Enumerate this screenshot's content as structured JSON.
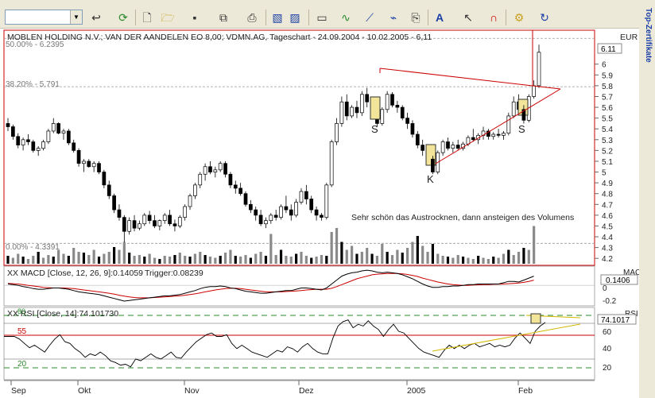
{
  "toolbar": {
    "symbol_input_value": "",
    "icons": [
      "back-icon",
      "refresh-icon",
      "new-document-icon",
      "open-folder-icon",
      "save-icon",
      "copy-icon",
      "print-icon",
      "chart-1-icon",
      "chart-2-icon",
      "layout-icon",
      "indicator-icon",
      "drawing-icon",
      "analysis-icon",
      "export-icon",
      "text-tool-icon",
      "pointer-icon",
      "magnet-icon",
      "settings-icon",
      "reload-icon"
    ]
  },
  "sidebar": {
    "vertical_label": "Top-Zertifikate"
  },
  "price_panel": {
    "title": "MOBLEN HOLDING N.V.; VAN DER AANDELEN EO 8,00; VDMN.AG, Tageschart - 24.09.2004 - 10.02.2005 - 6,11",
    "currency_label": "EUR",
    "current_price_badge": "6.11",
    "fib_labels": [
      "50.00% - 6.2395",
      "38.20% - 5.791",
      "0.00% - 4.3391"
    ],
    "pattern_labels": [
      "S",
      "K",
      "S"
    ],
    "annotation": "Sehr schön das Austrocknen, dann ansteigen des Volumens",
    "y_ticks": [
      "6",
      "5.9",
      "5.8",
      "5.7",
      "5.6",
      "5.5",
      "5.4",
      "5.3",
      "5.2",
      "5.1",
      "5",
      "4.9",
      "4.8",
      "4.7",
      "4.6",
      "4.5",
      "4.4",
      "4.3",
      "4.2"
    ]
  },
  "macd_panel": {
    "label_name": "XX MACD [Close, 12, 26, 9]:0.14059",
    "label_trigger": "Trigger:0.08239",
    "title_right": "MACD",
    "value_badge": "0.1406",
    "y_ticks": [
      "0",
      "-0.2"
    ]
  },
  "rsi_panel": {
    "label": "XX RSI [Close, 14]:74.101730",
    "title_right": "RSI",
    "value_badge": "74.1017",
    "level_labels": [
      "80",
      "55",
      "20"
    ],
    "y_ticks": [
      "60",
      "40",
      "20"
    ]
  },
  "x_axis": {
    "labels": [
      "Sep",
      "Okt",
      "Nov",
      "Dez",
      "2005",
      "Feb"
    ]
  },
  "colors": {
    "frame_red": "#cc0000",
    "price_up": "#ffffff",
    "price_down": "#000000",
    "macd_line": "#000000",
    "trigger_line": "#cc0000",
    "rsi_line": "#000000",
    "trend_yellow": "#d4b800",
    "fib_line": "#9a9a9a",
    "highlight_box": "#f2e59a"
  },
  "chart_data": {
    "type": "candlestick",
    "ylim": [
      4.15,
      6.3
    ],
    "candles": [
      [
        5.45,
        5.5,
        5.38,
        5.42
      ],
      [
        5.42,
        5.44,
        5.3,
        5.33
      ],
      [
        5.33,
        5.36,
        5.22,
        5.25
      ],
      [
        5.25,
        5.32,
        5.2,
        5.3
      ],
      [
        5.3,
        5.35,
        5.25,
        5.28
      ],
      [
        5.28,
        5.3,
        5.18,
        5.2
      ],
      [
        5.2,
        5.24,
        5.15,
        5.22
      ],
      [
        5.22,
        5.3,
        5.2,
        5.28
      ],
      [
        5.28,
        5.4,
        5.26,
        5.38
      ],
      [
        5.38,
        5.5,
        5.36,
        5.45
      ],
      [
        5.45,
        5.46,
        5.35,
        5.36
      ],
      [
        5.36,
        5.4,
        5.3,
        5.38
      ],
      [
        5.38,
        5.4,
        5.25,
        5.27
      ],
      [
        5.27,
        5.3,
        5.18,
        5.2
      ],
      [
        5.2,
        5.22,
        5.05,
        5.08
      ],
      [
        5.08,
        5.12,
        5.0,
        5.1
      ],
      [
        5.1,
        5.12,
        5.04,
        5.05
      ],
      [
        5.05,
        5.1,
        5.0,
        5.08
      ],
      [
        5.08,
        5.1,
        4.98,
        5.0
      ],
      [
        5.0,
        5.02,
        4.85,
        4.88
      ],
      [
        4.88,
        4.92,
        4.75,
        4.78
      ],
      [
        4.78,
        4.8,
        4.62,
        4.65
      ],
      [
        4.65,
        4.7,
        4.55,
        4.58
      ],
      [
        4.58,
        4.6,
        4.35,
        4.45
      ],
      [
        4.45,
        4.58,
        4.42,
        4.55
      ],
      [
        4.55,
        4.6,
        4.45,
        4.48
      ],
      [
        4.48,
        4.55,
        4.46,
        4.52
      ],
      [
        4.52,
        4.62,
        4.5,
        4.6
      ],
      [
        4.6,
        4.64,
        4.52,
        4.55
      ],
      [
        4.55,
        4.6,
        4.48,
        4.5
      ],
      [
        4.5,
        4.56,
        4.46,
        4.55
      ],
      [
        4.55,
        4.62,
        4.52,
        4.6
      ],
      [
        4.6,
        4.65,
        4.5,
        4.52
      ],
      [
        4.52,
        4.56,
        4.45,
        4.5
      ],
      [
        4.5,
        4.6,
        4.48,
        4.58
      ],
      [
        4.58,
        4.7,
        4.55,
        4.68
      ],
      [
        4.68,
        4.8,
        4.65,
        4.78
      ],
      [
        4.78,
        4.9,
        4.75,
        4.88
      ],
      [
        4.88,
        5.0,
        4.85,
        4.98
      ],
      [
        4.98,
        5.08,
        4.92,
        5.05
      ],
      [
        5.05,
        5.1,
        4.98,
        5.0
      ],
      [
        5.0,
        5.05,
        4.95,
        5.02
      ],
      [
        5.02,
        5.1,
        5.0,
        5.08
      ],
      [
        5.08,
        5.1,
        4.95,
        4.98
      ],
      [
        4.98,
        5.0,
        4.85,
        4.88
      ],
      [
        4.88,
        4.92,
        4.8,
        4.85
      ],
      [
        4.85,
        4.9,
        4.78,
        4.8
      ],
      [
        4.8,
        4.82,
        4.68,
        4.7
      ],
      [
        4.7,
        4.74,
        4.62,
        4.65
      ],
      [
        4.65,
        4.68,
        4.55,
        4.6
      ],
      [
        4.6,
        4.65,
        4.5,
        4.52
      ],
      [
        4.52,
        4.58,
        4.48,
        4.55
      ],
      [
        4.55,
        4.62,
        4.52,
        4.6
      ],
      [
        4.6,
        4.65,
        4.55,
        4.58
      ],
      [
        4.58,
        4.7,
        4.56,
        4.68
      ],
      [
        4.68,
        4.78,
        4.62,
        4.65
      ],
      [
        4.65,
        4.7,
        4.55,
        4.6
      ],
      [
        4.6,
        4.75,
        4.58,
        4.72
      ],
      [
        4.72,
        4.85,
        4.7,
        4.82
      ],
      [
        4.82,
        4.88,
        4.7,
        4.75
      ],
      [
        4.75,
        4.78,
        4.62,
        4.65
      ],
      [
        4.65,
        4.68,
        4.55,
        4.6
      ],
      [
        4.6,
        4.62,
        4.55,
        4.58
      ],
      [
        4.58,
        4.9,
        4.56,
        4.88
      ],
      [
        4.88,
        5.3,
        4.86,
        5.28
      ],
      [
        5.28,
        5.5,
        5.25,
        5.45
      ],
      [
        5.45,
        5.7,
        5.42,
        5.65
      ],
      [
        5.65,
        5.72,
        5.48,
        5.52
      ],
      [
        5.52,
        5.62,
        5.5,
        5.6
      ],
      [
        5.6,
        5.66,
        5.5,
        5.55
      ],
      [
        5.55,
        5.75,
        5.52,
        5.72
      ],
      [
        5.72,
        5.78,
        5.6,
        5.65
      ],
      [
        5.65,
        5.7,
        5.55,
        5.6
      ],
      [
        5.6,
        5.62,
        5.42,
        5.45
      ],
      [
        5.45,
        5.6,
        5.43,
        5.58
      ],
      [
        5.58,
        5.75,
        5.55,
        5.72
      ],
      [
        5.72,
        5.74,
        5.6,
        5.62
      ],
      [
        5.62,
        5.66,
        5.55,
        5.6
      ],
      [
        5.6,
        5.62,
        5.48,
        5.5
      ],
      [
        5.5,
        5.55,
        5.4,
        5.45
      ],
      [
        5.45,
        5.48,
        5.32,
        5.35
      ],
      [
        5.35,
        5.38,
        5.22,
        5.25
      ],
      [
        5.25,
        5.3,
        5.15,
        5.2
      ],
      [
        5.2,
        5.22,
        5.1,
        5.12
      ],
      [
        5.12,
        5.15,
        4.98,
        5.0
      ],
      [
        5.0,
        5.2,
        4.98,
        5.18
      ],
      [
        5.18,
        5.3,
        5.15,
        5.28
      ],
      [
        5.28,
        5.32,
        5.2,
        5.22
      ],
      [
        5.22,
        5.28,
        5.18,
        5.25
      ],
      [
        5.25,
        5.3,
        5.2,
        5.22
      ],
      [
        5.22,
        5.28,
        5.2,
        5.26
      ],
      [
        5.26,
        5.34,
        5.24,
        5.32
      ],
      [
        5.32,
        5.4,
        5.28,
        5.3
      ],
      [
        5.3,
        5.36,
        5.26,
        5.34
      ],
      [
        5.34,
        5.42,
        5.3,
        5.38
      ],
      [
        5.38,
        5.4,
        5.3,
        5.33
      ],
      [
        5.33,
        5.37,
        5.3,
        5.35
      ],
      [
        5.35,
        5.4,
        5.32,
        5.34
      ],
      [
        5.34,
        5.38,
        5.3,
        5.36
      ],
      [
        5.36,
        5.55,
        5.34,
        5.52
      ],
      [
        5.52,
        5.7,
        5.5,
        5.65
      ],
      [
        5.65,
        5.72,
        5.55,
        5.58
      ],
      [
        5.58,
        5.62,
        5.45,
        5.48
      ],
      [
        5.48,
        5.72,
        5.46,
        5.7
      ],
      [
        5.7,
        5.85,
        5.68,
        5.8
      ],
      [
        5.8,
        6.18,
        5.78,
        6.11
      ]
    ],
    "volume": [
      0.2,
      0.15,
      0.25,
      0.18,
      0.12,
      0.2,
      0.3,
      0.15,
      0.22,
      0.18,
      0.35,
      0.25,
      0.2,
      0.4,
      0.3,
      0.28,
      0.22,
      0.35,
      0.18,
      0.25,
      0.3,
      0.42,
      0.35,
      0.55,
      0.28,
      0.2,
      0.22,
      0.18,
      0.25,
      0.15,
      0.12,
      0.2,
      0.18,
      0.22,
      0.28,
      0.2,
      0.18,
      0.25,
      0.3,
      0.22,
      0.18,
      0.15,
      0.2,
      0.28,
      0.35,
      0.2,
      0.18,
      0.22,
      0.15,
      0.25,
      0.3,
      0.2,
      0.75,
      0.22,
      0.35,
      0.2,
      0.18,
      0.25,
      0.3,
      0.2,
      0.15,
      0.18,
      0.22,
      0.2,
      0.8,
      0.9,
      0.55,
      0.35,
      0.45,
      0.25,
      0.3,
      0.4,
      0.25,
      0.2,
      0.5,
      0.3,
      0.22,
      0.35,
      0.28,
      0.4,
      0.55,
      0.7,
      0.45,
      0.3,
      0.5,
      0.25,
      0.2,
      0.18,
      0.15,
      0.22,
      0.18,
      0.15,
      0.12,
      0.2,
      0.15,
      0.12,
      0.18,
      0.15,
      0.25,
      0.35,
      0.22,
      0.3,
      0.4,
      0.35,
      0.95
    ],
    "macd": [
      0.02,
      0.01,
      0.0,
      -0.02,
      -0.03,
      -0.05,
      -0.06,
      -0.06,
      -0.05,
      -0.04,
      -0.04,
      -0.05,
      -0.06,
      -0.08,
      -0.1,
      -0.11,
      -0.12,
      -0.13,
      -0.14,
      -0.16,
      -0.18,
      -0.2,
      -0.22,
      -0.24,
      -0.23,
      -0.22,
      -0.21,
      -0.2,
      -0.19,
      -0.18,
      -0.17,
      -0.16,
      -0.16,
      -0.15,
      -0.14,
      -0.12,
      -0.1,
      -0.08,
      -0.05,
      -0.03,
      -0.02,
      -0.02,
      -0.01,
      -0.02,
      -0.04,
      -0.05,
      -0.07,
      -0.09,
      -0.1,
      -0.11,
      -0.12,
      -0.12,
      -0.11,
      -0.1,
      -0.09,
      -0.08,
      -0.08,
      -0.06,
      -0.04,
      -0.04,
      -0.05,
      -0.06,
      -0.07,
      -0.04,
      0.02,
      0.08,
      0.14,
      0.17,
      0.19,
      0.2,
      0.22,
      0.23,
      0.22,
      0.2,
      0.19,
      0.2,
      0.19,
      0.18,
      0.16,
      0.13,
      0.1,
      0.06,
      0.02,
      -0.01,
      -0.03,
      -0.03,
      -0.02,
      -0.02,
      -0.01,
      -0.01,
      0.0,
      0.01,
      0.01,
      0.02,
      0.02,
      0.02,
      0.02,
      0.02,
      0.04,
      0.06,
      0.06,
      0.05,
      0.08,
      0.11,
      0.14
    ],
    "trigger": [
      0.03,
      0.025,
      0.02,
      0.01,
      0.0,
      -0.01,
      -0.02,
      -0.03,
      -0.035,
      -0.04,
      -0.04,
      -0.04,
      -0.045,
      -0.05,
      -0.06,
      -0.07,
      -0.08,
      -0.09,
      -0.1,
      -0.11,
      -0.12,
      -0.135,
      -0.15,
      -0.165,
      -0.175,
      -0.185,
      -0.19,
      -0.19,
      -0.19,
      -0.185,
      -0.18,
      -0.175,
      -0.17,
      -0.165,
      -0.16,
      -0.15,
      -0.14,
      -0.13,
      -0.115,
      -0.1,
      -0.085,
      -0.07,
      -0.06,
      -0.05,
      -0.045,
      -0.045,
      -0.05,
      -0.06,
      -0.07,
      -0.08,
      -0.09,
      -0.1,
      -0.1,
      -0.1,
      -0.1,
      -0.095,
      -0.09,
      -0.085,
      -0.08,
      -0.07,
      -0.065,
      -0.06,
      -0.06,
      -0.06,
      -0.045,
      -0.02,
      0.01,
      0.04,
      0.07,
      0.1,
      0.12,
      0.14,
      0.16,
      0.17,
      0.175,
      0.18,
      0.18,
      0.18,
      0.175,
      0.165,
      0.15,
      0.135,
      0.11,
      0.09,
      0.07,
      0.05,
      0.035,
      0.02,
      0.01,
      0.005,
      0.0,
      0.0,
      0.005,
      0.008,
      0.01,
      0.012,
      0.015,
      0.016,
      0.02,
      0.025,
      0.03,
      0.035,
      0.045,
      0.06,
      0.08
    ],
    "rsi": [
      58,
      55,
      50,
      45,
      48,
      44,
      40,
      48,
      55,
      60,
      52,
      50,
      44,
      40,
      34,
      38,
      36,
      40,
      36,
      30,
      28,
      25,
      26,
      23,
      32,
      30,
      34,
      38,
      34,
      32,
      36,
      40,
      34,
      33,
      40,
      46,
      52,
      56,
      60,
      62,
      58,
      58,
      60,
      50,
      44,
      48,
      44,
      40,
      38,
      36,
      34,
      38,
      42,
      40,
      46,
      44,
      40,
      46,
      50,
      44,
      40,
      38,
      38,
      56,
      70,
      75,
      77,
      68,
      72,
      70,
      76,
      70,
      66,
      58,
      66,
      72,
      64,
      62,
      56,
      50,
      44,
      40,
      38,
      36,
      34,
      42,
      48,
      44,
      48,
      44,
      48,
      50,
      46,
      48,
      50,
      46,
      48,
      46,
      48,
      56,
      62,
      56,
      50,
      64,
      70,
      74.1
    ]
  }
}
